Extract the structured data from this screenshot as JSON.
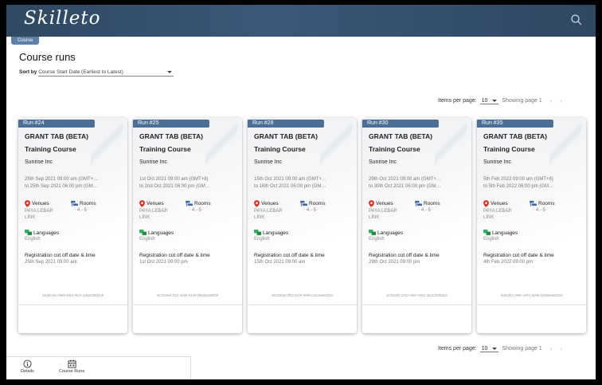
{
  "app": {
    "logo": "Skilleto"
  },
  "breadcrumb": "Course",
  "page": {
    "title": "Course runs"
  },
  "sort": {
    "label": "Sort by",
    "value": "Course Start Date (Earliest to Latest)"
  },
  "pagination": {
    "items_label": "Items per page:",
    "per_page": "10",
    "showing": "Showing page 1",
    "prev": "‹",
    "next": "›"
  },
  "cards": [
    {
      "run": "Run #24",
      "title1": "GRANT TAB (BETA)",
      "title2": "Training Course",
      "company": "Sunrise Inc",
      "date1": "25th Sep 2021 09:00 am (GMT+…",
      "date2": "to 25th Sep 2021 06:00 pm (GM…",
      "venues_label": "Venues",
      "venue": "PAYA LEBAR LINK",
      "rooms_label": "Rooms",
      "rooms": "4 - 5",
      "languages_label": "Languages",
      "language": "English",
      "cutoff_label": "Registration cut off date & time",
      "cutoff": "25th Sep 2021 09:00 am",
      "uuid": "3448c16c-d989-4dc3-963c-1de2c065fcc8"
    },
    {
      "run": "Run #25",
      "title1": "GRANT TAB (BETA)",
      "title2": "Training Course",
      "company": "Sunrise Inc",
      "date1": "1st Oct 2021 09:00 am (GMT+8)",
      "date2": "to 2nd Oct 2021 06:00 pm (GM…",
      "venues_label": "Venues",
      "venue": "PAYA LEBAR LINK",
      "rooms_label": "Rooms",
      "rooms": "4 - 5",
      "languages_label": "Languages",
      "language": "English",
      "cutoff_label": "Registration cut off date & time",
      "cutoff": "1st Oct 2021 09:00 pm",
      "uuid": "0c43c5ed-f101-4009-9139-d98abc855f28"
    },
    {
      "run": "Run #28",
      "title1": "GRANT TAB (BETA)",
      "title2": "Training Course",
      "company": "Sunrise Inc",
      "date1": "15th Oct 2021 09:00 am (GMT+…",
      "date2": "to 16th Oct 2021 06:00 pm (GM…",
      "venues_label": "Venues",
      "venue": "PAYA LEBAR LINK",
      "rooms_label": "Rooms",
      "rooms": "4 - 5",
      "languages_label": "Languages",
      "language": "English",
      "cutoff_label": "Registration cut off date & time",
      "cutoff": "15th Oct 2021 09:00 am",
      "uuid": "e6c20c62-0f52-4278-999f-c22c4e681044"
    },
    {
      "run": "Run #30",
      "title1": "GRANT TAB (BETA)",
      "title2": "Training Course",
      "company": "Sunrise Inc",
      "date1": "29th Oct 2021 09:00 am (GMT+…",
      "date2": "to 30th Oct 2021 06:00 pm (GM…",
      "venues_label": "Venues",
      "venue": "PAYA LEBAR LINK",
      "rooms_label": "Rooms",
      "rooms": "4 - 5",
      "languages_label": "Languages",
      "language": "English",
      "cutoff_label": "Registration cut off date & time",
      "cutoff": "29th Oct 2021 09:00 pm",
      "uuid": "4cd528f2-2701-4567-0501-3cc1335fcd22"
    },
    {
      "run": "Run #35",
      "title1": "GRANT TAB (BETA)",
      "title2": "Training Course",
      "company": "Sunrise Inc",
      "date1": "5th Feb 2022 09:00 am (GMT+8)",
      "date2": "to 5th Feb 2022 06:00 pm (GM…",
      "venues_label": "Venues",
      "venue": "PAYA LEBAR LINK",
      "rooms_label": "Rooms",
      "rooms": "4 - 5",
      "languages_label": "Languages",
      "language": "English",
      "cutoff_label": "Registration cut off date & time",
      "cutoff": "4th Feb 2022 09:00 pm",
      "uuid": "5c9c6fc1-096c-4972-a096-b3558e6e5320"
    }
  ],
  "footer": {
    "details_label": "Details",
    "course_runs_label": "Course Runs"
  },
  "colors": {
    "topbar": "#34506e",
    "tab": "#4c6f95",
    "venue_pin": "#e0342b",
    "room_icon": "#3b6ea5",
    "language_icon": "#2fae5a"
  }
}
